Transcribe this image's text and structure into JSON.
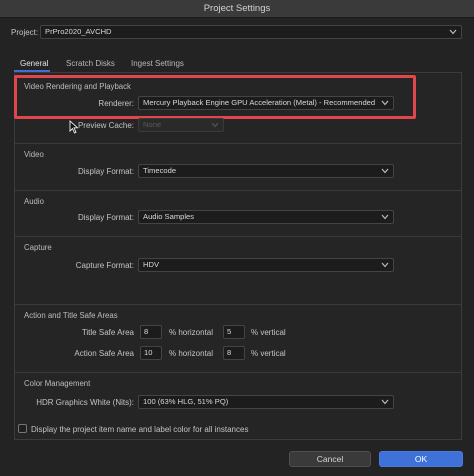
{
  "window": {
    "title": "Project Settings"
  },
  "project": {
    "label": "Project:",
    "value": "PrPro2020_AVCHD"
  },
  "tabs": [
    {
      "label": "General",
      "active": true
    },
    {
      "label": "Scratch Disks",
      "active": false
    },
    {
      "label": "Ingest Settings",
      "active": false
    }
  ],
  "video_rendering": {
    "title": "Video Rendering and Playback",
    "renderer_label": "Renderer:",
    "renderer_value": "Mercury Playback Engine GPU Acceleration (Metal) - Recommended",
    "preview_cache_label": "Preview Cache:",
    "preview_cache_value": "None"
  },
  "video": {
    "title": "Video",
    "display_format_label": "Display Format:",
    "display_format_value": "Timecode"
  },
  "audio": {
    "title": "Audio",
    "display_format_label": "Display Format:",
    "display_format_value": "Audio Samples"
  },
  "capture": {
    "title": "Capture",
    "capture_format_label": "Capture Format:",
    "capture_format_value": "HDV"
  },
  "safe_areas": {
    "title": "Action and Title Safe Areas",
    "title_safe_label": "Title Safe Area",
    "title_safe_h": "8",
    "title_safe_v": "5",
    "action_safe_label": "Action Safe Area",
    "action_safe_h": "10",
    "action_safe_v": "8",
    "h_unit": "% horizontal",
    "v_unit": "% vertical"
  },
  "color_management": {
    "title": "Color Management",
    "hdr_label": "HDR Graphics White (Nits):",
    "hdr_value": "100 (63% HLG, 51% PQ)"
  },
  "footer": {
    "checkbox_label": "Display the project item name and label color for all instances",
    "checkbox_checked": false,
    "cancel_label": "Cancel",
    "ok_label": "OK"
  },
  "colors": {
    "accent": "#3f72d9",
    "highlight": "#e0474d",
    "background": "#232323"
  }
}
